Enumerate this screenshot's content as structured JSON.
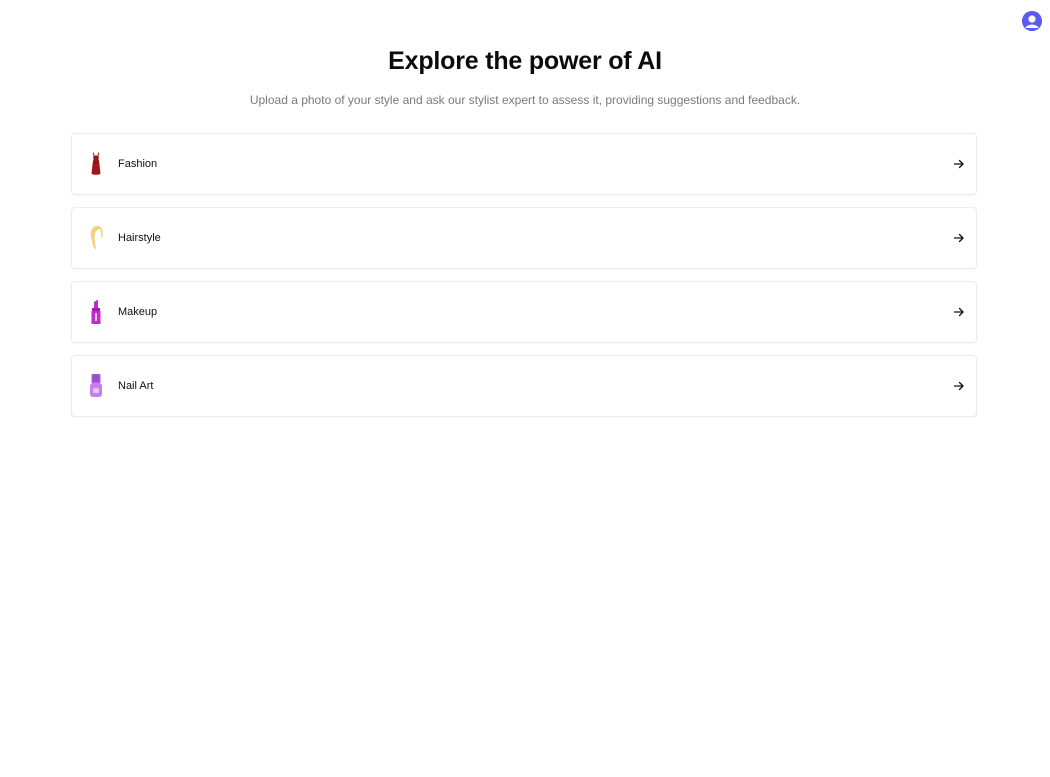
{
  "header": {
    "title": "Explore the power of AI",
    "subtitle": "Upload a photo of your style and ask our stylist expert to assess it, providing suggestions and feedback."
  },
  "user": {
    "avatar_icon": "user-avatar-icon",
    "avatar_color": "#5b5cf0"
  },
  "categories": [
    {
      "label": "Fashion",
      "icon": "dress-icon",
      "color": "#a0151a"
    },
    {
      "label": "Hairstyle",
      "icon": "hair-icon",
      "color": "#f1d27a"
    },
    {
      "label": "Makeup",
      "icon": "lipstick-icon",
      "color": "#c02bc9"
    },
    {
      "label": "Nail Art",
      "icon": "nail-polish-icon",
      "color": "#a65ad8"
    }
  ],
  "arrow_icon": "arrow-right-icon"
}
